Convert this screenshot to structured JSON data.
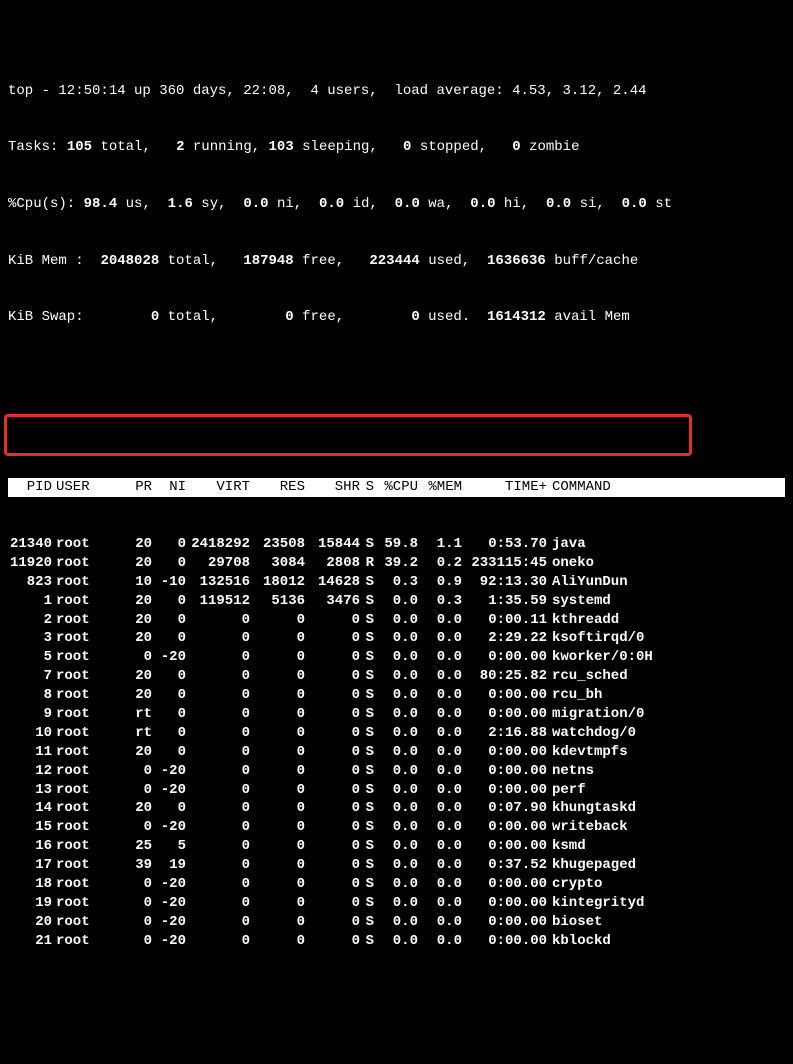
{
  "summary": {
    "line1": "top - 12:50:14 up 360 days, 22:08,  4 users,  load average: 4.53, 3.12, 2.44",
    "tasks": {
      "prefix": "Tasks:",
      "total": "105",
      "total_label": "total,",
      "running": "2",
      "running_label": "running,",
      "sleeping": "103",
      "sleeping_label": "sleeping,",
      "stopped": "0",
      "stopped_label": "stopped,",
      "zombie": "0",
      "zombie_label": "zombie"
    },
    "cpu": {
      "prefix": "%Cpu(s):",
      "us": "98.4",
      "us_l": "us,",
      "sy": "1.6",
      "sy_l": "sy,",
      "ni": "0.0",
      "ni_l": "ni,",
      "id": "0.0",
      "id_l": "id,",
      "wa": "0.0",
      "wa_l": "wa,",
      "hi": "0.0",
      "hi_l": "hi,",
      "si": "0.0",
      "si_l": "si,",
      "st": "0.0",
      "st_l": "st"
    },
    "mem": {
      "prefix": "KiB Mem :",
      "total": "2048028",
      "total_l": "total,",
      "free": "187948",
      "free_l": "free,",
      "used": "223444",
      "used_l": "used,",
      "buff": "1636636",
      "buff_l": "buff/cache"
    },
    "swap": {
      "prefix": "KiB Swap:",
      "total": "0",
      "total_l": "total,",
      "free": "0",
      "free_l": "free,",
      "used": "0",
      "used_l": "used.",
      "avail": "1614312",
      "avail_l": "avail Mem"
    }
  },
  "columns": {
    "pid": "PID",
    "user": "USER",
    "pr": "PR",
    "ni": "NI",
    "virt": "VIRT",
    "res": "RES",
    "shr": "SHR",
    "s": "S",
    "cpu": "%CPU",
    "mem": "%MEM",
    "time": "TIME+",
    "cmd": "COMMAND"
  },
  "processes": [
    {
      "pid": "21340",
      "user": "root",
      "pr": "20",
      "ni": "0",
      "virt": "2418292",
      "res": "23508",
      "shr": "15844",
      "s": "S",
      "cpu": "59.8",
      "mem": "1.1",
      "time": "0:53.70",
      "cmd": "java"
    },
    {
      "pid": "11920",
      "user": "root",
      "pr": "20",
      "ni": "0",
      "virt": "29708",
      "res": "3084",
      "shr": "2808",
      "s": "R",
      "cpu": "39.2",
      "mem": "0.2",
      "time": "233115:45",
      "cmd": "oneko"
    },
    {
      "pid": "823",
      "user": "root",
      "pr": "10",
      "ni": "-10",
      "virt": "132516",
      "res": "18012",
      "shr": "14628",
      "s": "S",
      "cpu": "0.3",
      "mem": "0.9",
      "time": "92:13.30",
      "cmd": "AliYunDun"
    },
    {
      "pid": "1",
      "user": "root",
      "pr": "20",
      "ni": "0",
      "virt": "119512",
      "res": "5136",
      "shr": "3476",
      "s": "S",
      "cpu": "0.0",
      "mem": "0.3",
      "time": "1:35.59",
      "cmd": "systemd"
    },
    {
      "pid": "2",
      "user": "root",
      "pr": "20",
      "ni": "0",
      "virt": "0",
      "res": "0",
      "shr": "0",
      "s": "S",
      "cpu": "0.0",
      "mem": "0.0",
      "time": "0:00.11",
      "cmd": "kthreadd"
    },
    {
      "pid": "3",
      "user": "root",
      "pr": "20",
      "ni": "0",
      "virt": "0",
      "res": "0",
      "shr": "0",
      "s": "S",
      "cpu": "0.0",
      "mem": "0.0",
      "time": "2:29.22",
      "cmd": "ksoftirqd/0"
    },
    {
      "pid": "5",
      "user": "root",
      "pr": "0",
      "ni": "-20",
      "virt": "0",
      "res": "0",
      "shr": "0",
      "s": "S",
      "cpu": "0.0",
      "mem": "0.0",
      "time": "0:00.00",
      "cmd": "kworker/0:0H"
    },
    {
      "pid": "7",
      "user": "root",
      "pr": "20",
      "ni": "0",
      "virt": "0",
      "res": "0",
      "shr": "0",
      "s": "S",
      "cpu": "0.0",
      "mem": "0.0",
      "time": "80:25.82",
      "cmd": "rcu_sched"
    },
    {
      "pid": "8",
      "user": "root",
      "pr": "20",
      "ni": "0",
      "virt": "0",
      "res": "0",
      "shr": "0",
      "s": "S",
      "cpu": "0.0",
      "mem": "0.0",
      "time": "0:00.00",
      "cmd": "rcu_bh"
    },
    {
      "pid": "9",
      "user": "root",
      "pr": "rt",
      "ni": "0",
      "virt": "0",
      "res": "0",
      "shr": "0",
      "s": "S",
      "cpu": "0.0",
      "mem": "0.0",
      "time": "0:00.00",
      "cmd": "migration/0"
    },
    {
      "pid": "10",
      "user": "root",
      "pr": "rt",
      "ni": "0",
      "virt": "0",
      "res": "0",
      "shr": "0",
      "s": "S",
      "cpu": "0.0",
      "mem": "0.0",
      "time": "2:16.88",
      "cmd": "watchdog/0"
    },
    {
      "pid": "11",
      "user": "root",
      "pr": "20",
      "ni": "0",
      "virt": "0",
      "res": "0",
      "shr": "0",
      "s": "S",
      "cpu": "0.0",
      "mem": "0.0",
      "time": "0:00.00",
      "cmd": "kdevtmpfs"
    },
    {
      "pid": "12",
      "user": "root",
      "pr": "0",
      "ni": "-20",
      "virt": "0",
      "res": "0",
      "shr": "0",
      "s": "S",
      "cpu": "0.0",
      "mem": "0.0",
      "time": "0:00.00",
      "cmd": "netns"
    },
    {
      "pid": "13",
      "user": "root",
      "pr": "0",
      "ni": "-20",
      "virt": "0",
      "res": "0",
      "shr": "0",
      "s": "S",
      "cpu": "0.0",
      "mem": "0.0",
      "time": "0:00.00",
      "cmd": "perf"
    },
    {
      "pid": "14",
      "user": "root",
      "pr": "20",
      "ni": "0",
      "virt": "0",
      "res": "0",
      "shr": "0",
      "s": "S",
      "cpu": "0.0",
      "mem": "0.0",
      "time": "0:07.90",
      "cmd": "khungtaskd"
    },
    {
      "pid": "15",
      "user": "root",
      "pr": "0",
      "ni": "-20",
      "virt": "0",
      "res": "0",
      "shr": "0",
      "s": "S",
      "cpu": "0.0",
      "mem": "0.0",
      "time": "0:00.00",
      "cmd": "writeback"
    },
    {
      "pid": "16",
      "user": "root",
      "pr": "25",
      "ni": "5",
      "virt": "0",
      "res": "0",
      "shr": "0",
      "s": "S",
      "cpu": "0.0",
      "mem": "0.0",
      "time": "0:00.00",
      "cmd": "ksmd"
    },
    {
      "pid": "17",
      "user": "root",
      "pr": "39",
      "ni": "19",
      "virt": "0",
      "res": "0",
      "shr": "0",
      "s": "S",
      "cpu": "0.0",
      "mem": "0.0",
      "time": "0:37.52",
      "cmd": "khugepaged"
    },
    {
      "pid": "18",
      "user": "root",
      "pr": "0",
      "ni": "-20",
      "virt": "0",
      "res": "0",
      "shr": "0",
      "s": "S",
      "cpu": "0.0",
      "mem": "0.0",
      "time": "0:00.00",
      "cmd": "crypto"
    },
    {
      "pid": "19",
      "user": "root",
      "pr": "0",
      "ni": "-20",
      "virt": "0",
      "res": "0",
      "shr": "0",
      "s": "S",
      "cpu": "0.0",
      "mem": "0.0",
      "time": "0:00.00",
      "cmd": "kintegrityd"
    },
    {
      "pid": "20",
      "user": "root",
      "pr": "0",
      "ni": "-20",
      "virt": "0",
      "res": "0",
      "shr": "0",
      "s": "S",
      "cpu": "0.0",
      "mem": "0.0",
      "time": "0:00.00",
      "cmd": "bioset"
    },
    {
      "pid": "21",
      "user": "root",
      "pr": "0",
      "ni": "-20",
      "virt": "0",
      "res": "0",
      "shr": "0",
      "s": "S",
      "cpu": "0.0",
      "mem": "0.0",
      "time": "0:00.00",
      "cmd": "kblockd"
    }
  ]
}
